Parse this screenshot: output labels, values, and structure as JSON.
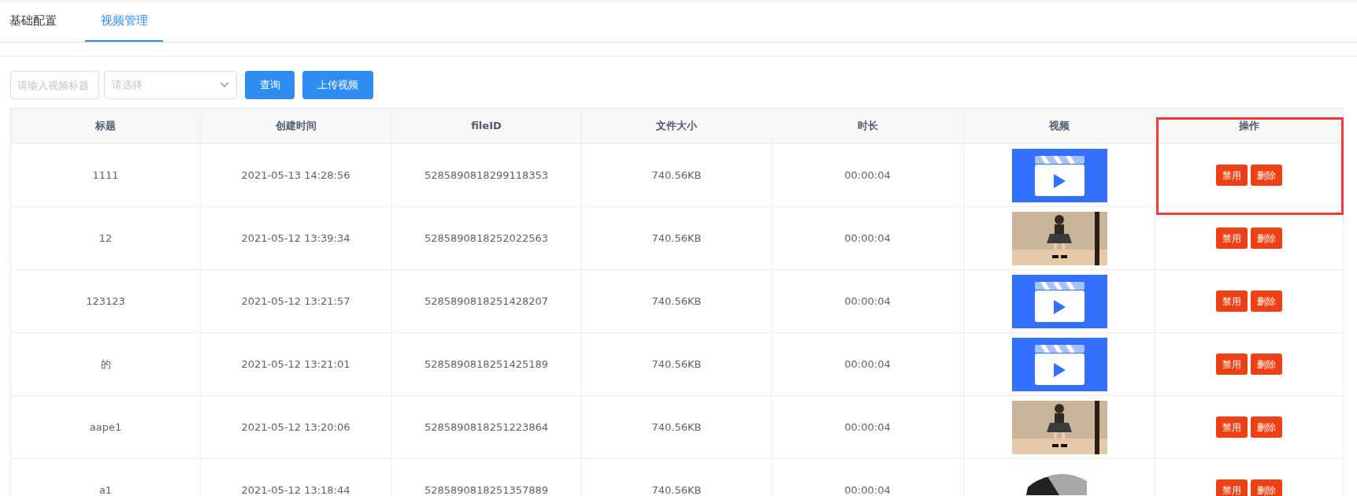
{
  "tabs": [
    {
      "label": "基础配置",
      "selected": false
    },
    {
      "label": "视频管理",
      "selected": true
    }
  ],
  "toolbar": {
    "title_field": {
      "placeholder": "请输入视频标题"
    },
    "select": {
      "placeholder": "请选择"
    },
    "buttons": [
      "查询",
      "上传视频"
    ]
  },
  "table": {
    "columns": [
      "标题",
      "创建时间",
      "fileID",
      "文件大小",
      "时长",
      "视频",
      "操作"
    ],
    "highlight_actions": true,
    "rows": [
      {
        "title": "1111",
        "created": "2021-05-13 14:28:56",
        "file_id": "5285890818299118353",
        "size": "740.56KB",
        "duration": "00:00:04",
        "video": {
          "kind": "clapper"
        },
        "actions": [
          "禁用",
          "删除"
        ]
      },
      {
        "title": "12",
        "created": "2021-05-12 13:39:34",
        "file_id": "5285890818252022563",
        "size": "740.56KB",
        "duration": "00:00:04",
        "actions": [
          "禁用",
          "删除"
        ]
      },
      {
        "title": "123123",
        "created": "2021-05-12 13:21:57",
        "file_id": "5285890818251428207",
        "size": "740.56KB",
        "duration": "00:00:04",
        "video": {
          "kind": "clapper"
        },
        "actions": [
          "禁用",
          "删除"
        ]
      },
      {
        "title": "的",
        "created": "2021-05-12 13:21:01",
        "file_id": "5285890818251425189",
        "size": "740.56KB",
        "duration": "00:00:04",
        "video": {
          "kind": "clapper"
        },
        "actions": [
          "禁用",
          "删除"
        ]
      },
      {
        "title": "aape1",
        "created": "2021-05-12 13:20:06",
        "file_id": "5285890818251223864",
        "size": "740.56KB",
        "duration": "00:00:04",
        "actions": [
          "禁用",
          "删除"
        ]
      },
      {
        "title": "a1",
        "created": "2021-05-12 13:18:44",
        "file_id": "5285890818251357889",
        "size": "740.56KB",
        "duration": "00:00:04",
        "actions": [
          "禁用",
          "删除"
        ]
      }
    ]
  }
}
